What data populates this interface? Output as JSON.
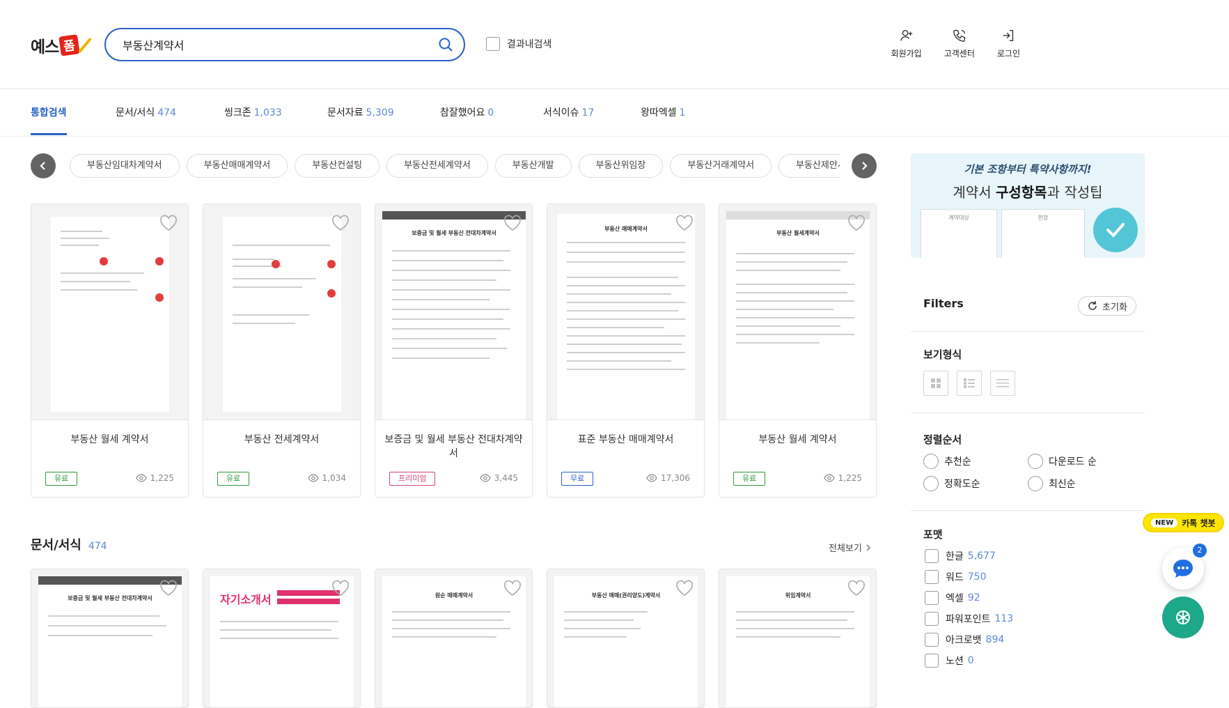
{
  "header": {
    "logo_text": "예스",
    "logo_mark": "폼",
    "search_value": "부동산계약서",
    "in_result_label": "결과내검색",
    "links": [
      {
        "label": "회원가입",
        "icon": "user-plus-icon"
      },
      {
        "label": "고객센터",
        "icon": "phone-icon"
      },
      {
        "label": "로그인",
        "icon": "login-icon"
      }
    ]
  },
  "tabs": [
    {
      "label": "통합검색",
      "count": ""
    },
    {
      "label": "문서/서식",
      "count": "474"
    },
    {
      "label": "씽크존",
      "count": "1,033"
    },
    {
      "label": "문서자료",
      "count": "5,309"
    },
    {
      "label": "참잘했어요",
      "count": "0"
    },
    {
      "label": "서식이슈",
      "count": "17"
    },
    {
      "label": "왕따엑셀",
      "count": "1"
    }
  ],
  "chips": [
    "부동산임대차계약서",
    "부동산매매계약서",
    "부동산컨설팅",
    "부동산전세계약서",
    "부동산개발",
    "부동산위임장",
    "부동산거래계약서",
    "부동산제안서"
  ],
  "cards": [
    {
      "title": "부동산 월세 계약서",
      "badge": "유료",
      "badge_type": "paid",
      "views": "1,225"
    },
    {
      "title": "부동산 전세계약서",
      "badge": "유료",
      "badge_type": "paid",
      "views": "1,034"
    },
    {
      "title": "보증금 및 월세 부동산 전대차계약서",
      "badge": "프리미엄",
      "badge_type": "premium",
      "views": "3,445"
    },
    {
      "title": "표준 부동산 매매계약서",
      "badge": "무료",
      "badge_type": "free",
      "views": "17,306"
    },
    {
      "title": "부동산 월세 계약서",
      "badge": "유료",
      "badge_type": "paid",
      "views": "1,225"
    }
  ],
  "thumb_titles": [
    "",
    "",
    "보증금 및 월세 부동산 전대차계약서",
    "부동산 매매계약서",
    "부동산 월세계약서"
  ],
  "section": {
    "title": "문서/서식",
    "count": "474",
    "more": "전체보기"
  },
  "section_thumb_titles": [
    "보증금 및 월세 부동산 전대차계약서",
    "자기소개서",
    "원순 매매계약서",
    "부동산 매매(권리양도)계약서",
    "위임계약서"
  ],
  "sidebar": {
    "banner_sub": "기본 조항부터 특약사항까지!",
    "banner_main_pre": "계약서 ",
    "banner_main_bold": "구성항목",
    "banner_main_post": "과 작성팁",
    "banner_doc_labels": [
      "계약대상",
      "한장"
    ],
    "filters_title": "Filters",
    "reset_label": "초기화",
    "view_title": "보기형식",
    "sort_title": "정렬순서",
    "sort_options": [
      "추천순",
      "다운로드 순",
      "정확도순",
      "최신순"
    ],
    "format_title": "포맷",
    "formats": [
      {
        "label": "한글",
        "count": "5,677"
      },
      {
        "label": "워드",
        "count": "750"
      },
      {
        "label": "엑셀",
        "count": "92"
      },
      {
        "label": "파워포인트",
        "count": "113"
      },
      {
        "label": "아크로뱃",
        "count": "894"
      },
      {
        "label": "노션",
        "count": "0"
      }
    ]
  },
  "floating": {
    "kakao_new": "NEW",
    "kakao_label": "카톡 챗봇",
    "chat_badge": "2"
  },
  "colors": {
    "accent": "#2a62c8",
    "paid": "#2f9a3c",
    "premium": "#d6457a",
    "count": "#5d8ad6"
  }
}
